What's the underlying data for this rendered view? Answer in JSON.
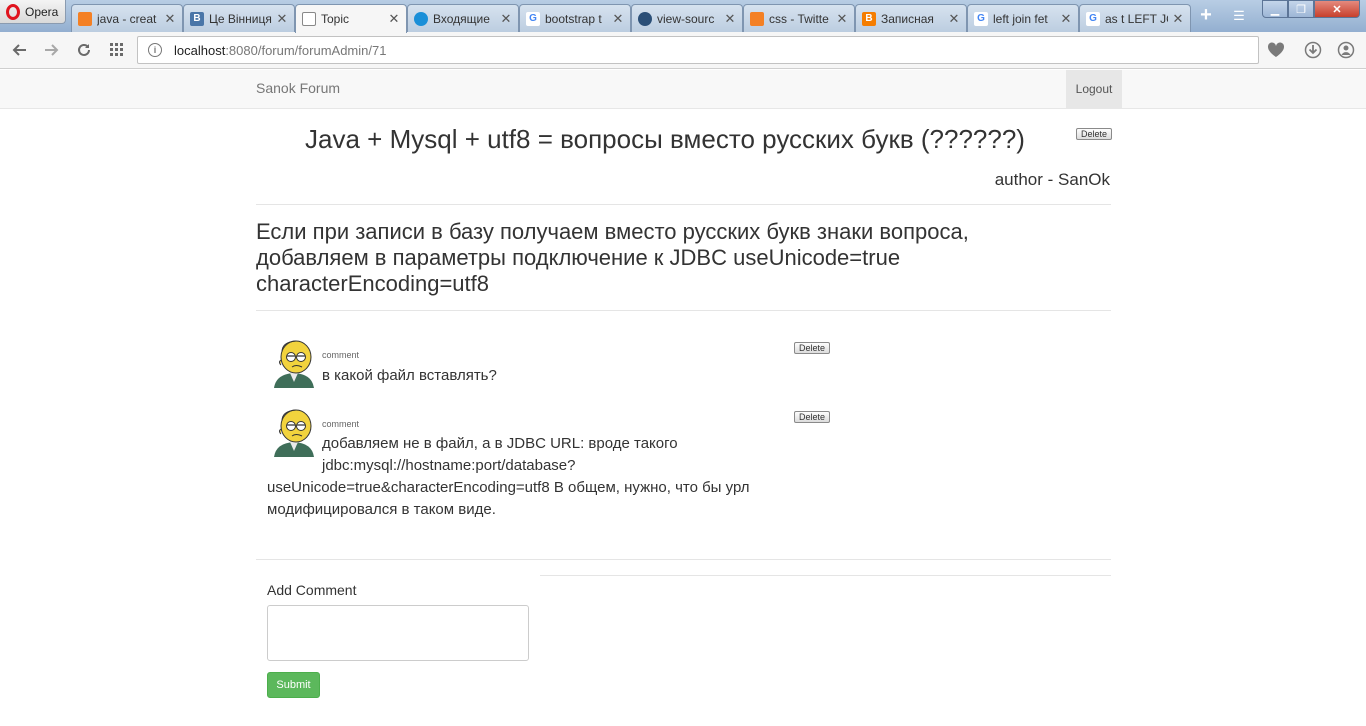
{
  "browser": {
    "menu_label": "Opera",
    "tabs": [
      {
        "title": "java - creat",
        "icon": "stackoverflow-icon",
        "color": "#f48024"
      },
      {
        "title": "Це Вінниця",
        "icon": "vk-icon",
        "color": "#4a76a8",
        "glyph": "В"
      },
      {
        "title": "Topic",
        "icon": "page-icon",
        "color": "#888888"
      },
      {
        "title": "Входящие",
        "icon": "mail-icon",
        "color": "#1a8fd8"
      },
      {
        "title": "bootstrap t",
        "icon": "google-icon",
        "color": "#4285f4",
        "glyph": "G"
      },
      {
        "title": "view-sourc",
        "icon": "globe-icon",
        "color": "#2b4f77"
      },
      {
        "title": "css - Twitte",
        "icon": "stackoverflow-icon",
        "color": "#f48024"
      },
      {
        "title": "Записная",
        "icon": "blogger-icon",
        "color": "#f57d00",
        "glyph": "B"
      },
      {
        "title": "left join fet",
        "icon": "google-icon",
        "color": "#4285f4",
        "glyph": "G"
      },
      {
        "title": "as t LEFT JO",
        "icon": "google-icon",
        "color": "#4285f4",
        "glyph": "G"
      }
    ],
    "url_host": "localhost",
    "url_path": ":8080/forum/forumAdmin/71"
  },
  "nav": {
    "brand": "Sanok Forum",
    "logout": "Logout"
  },
  "topic": {
    "title": "Java + Mysql + utf8 = вопросы вместо русских букв (??????)",
    "delete_label": "Delete",
    "author": "author - SanOk",
    "body": "Если при записи в базу получаем вместо русских букв знаки вопроса, добавляем в параметры подключение к JDBC useUnicode=true characterEncoding=utf8"
  },
  "comments": [
    {
      "label": "comment",
      "delete_label": "Delete",
      "lines": [
        "в какой файл вставлять?"
      ]
    },
    {
      "label": "comment",
      "delete_label": "Delete",
      "lines": [
        "добавляем не в файл, а в JDBC URL: вроде такого",
        "jdbc:mysql://hostname:port/database?",
        "useUnicode=true&characterEncoding=utf8 В общем, нужно, что бы урл",
        "модифицировался в таком виде."
      ]
    }
  ],
  "form": {
    "add_label": "Add Comment",
    "submit_label": "Submit"
  }
}
